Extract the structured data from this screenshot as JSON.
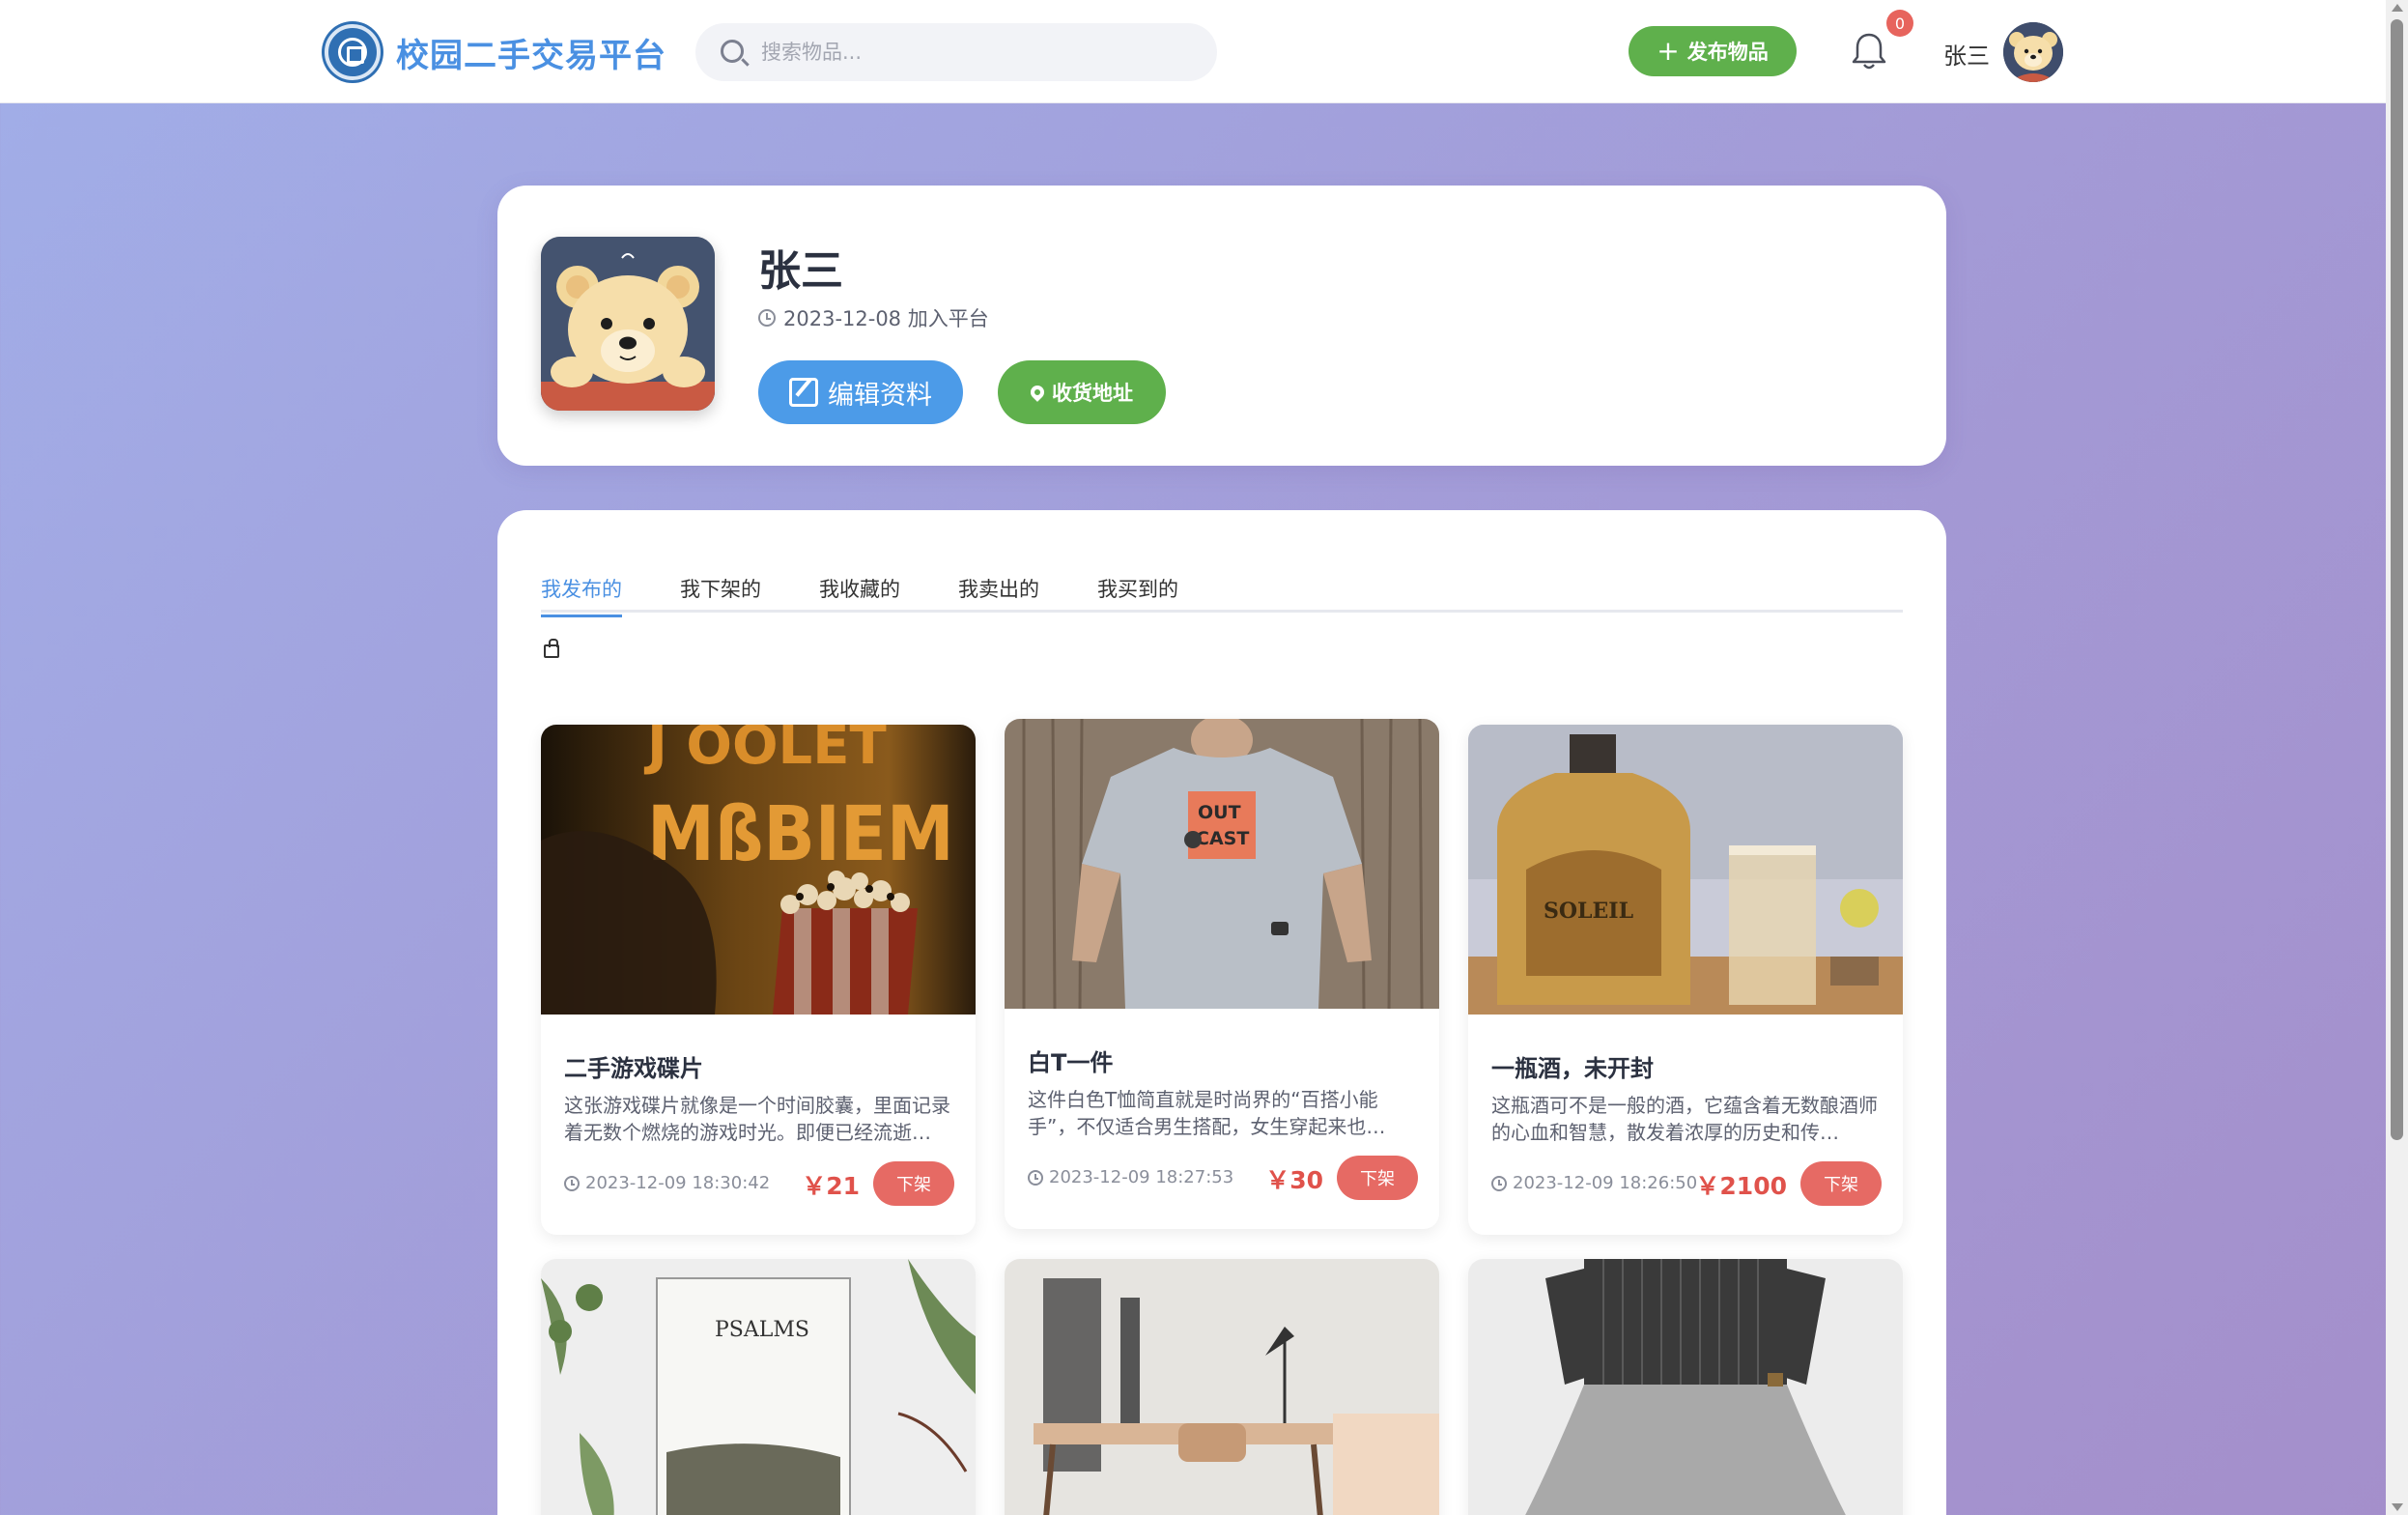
{
  "header": {
    "brand": "校园二手交易平台",
    "search_placeholder": "搜索物品...",
    "publish_label": "发布物品",
    "notification_count": "0",
    "user_name": "张三"
  },
  "profile": {
    "name": "张三",
    "join_text": "2023-12-08 加入平台",
    "edit_label": "编辑资料",
    "address_label": "收货地址"
  },
  "tabs": [
    "我发布的",
    "我下架的",
    "我收藏的",
    "我卖出的",
    "我买到的"
  ],
  "active_tab": "我发布的",
  "products": [
    {
      "title": "二手游戏碟片",
      "desc": "这张游戏碟片就像是一个时间胶囊，里面记录着无数个燃烧的游戏时光。即便已经流逝…",
      "time": "2023-12-09 18:30:42",
      "price": "￥21",
      "action": "下架",
      "image": "cinema-popcorn"
    },
    {
      "title": "白T一件",
      "desc": "这件白色T恤简直就是时尚界的“百搭小能手”，不仅适合男生搭配，女生穿起来也…",
      "time": "2023-12-09 18:27:53",
      "price": "￥30",
      "action": "下架",
      "image": "white-tshirt"
    },
    {
      "title": "一瓶酒，未开封",
      "desc": "这瓶酒可不是一般的酒，它蕴含着无数酿酒师的心血和智慧，散发着浓厚的历史和传…",
      "time": "2023-12-09 18:26:50",
      "price": "￥2100",
      "action": "下架",
      "image": "liquor-bottle"
    },
    {
      "image": "psalms-book",
      "image_text": "PSALMS"
    },
    {
      "image": "desk-chair"
    },
    {
      "image": "striped-blouse"
    }
  ],
  "colors": {
    "brand_blue": "#4a90e2",
    "green": "#5fb04c",
    "price_red": "#e0524b",
    "off_button": "#e66a64",
    "badge_red": "#e7645d"
  }
}
